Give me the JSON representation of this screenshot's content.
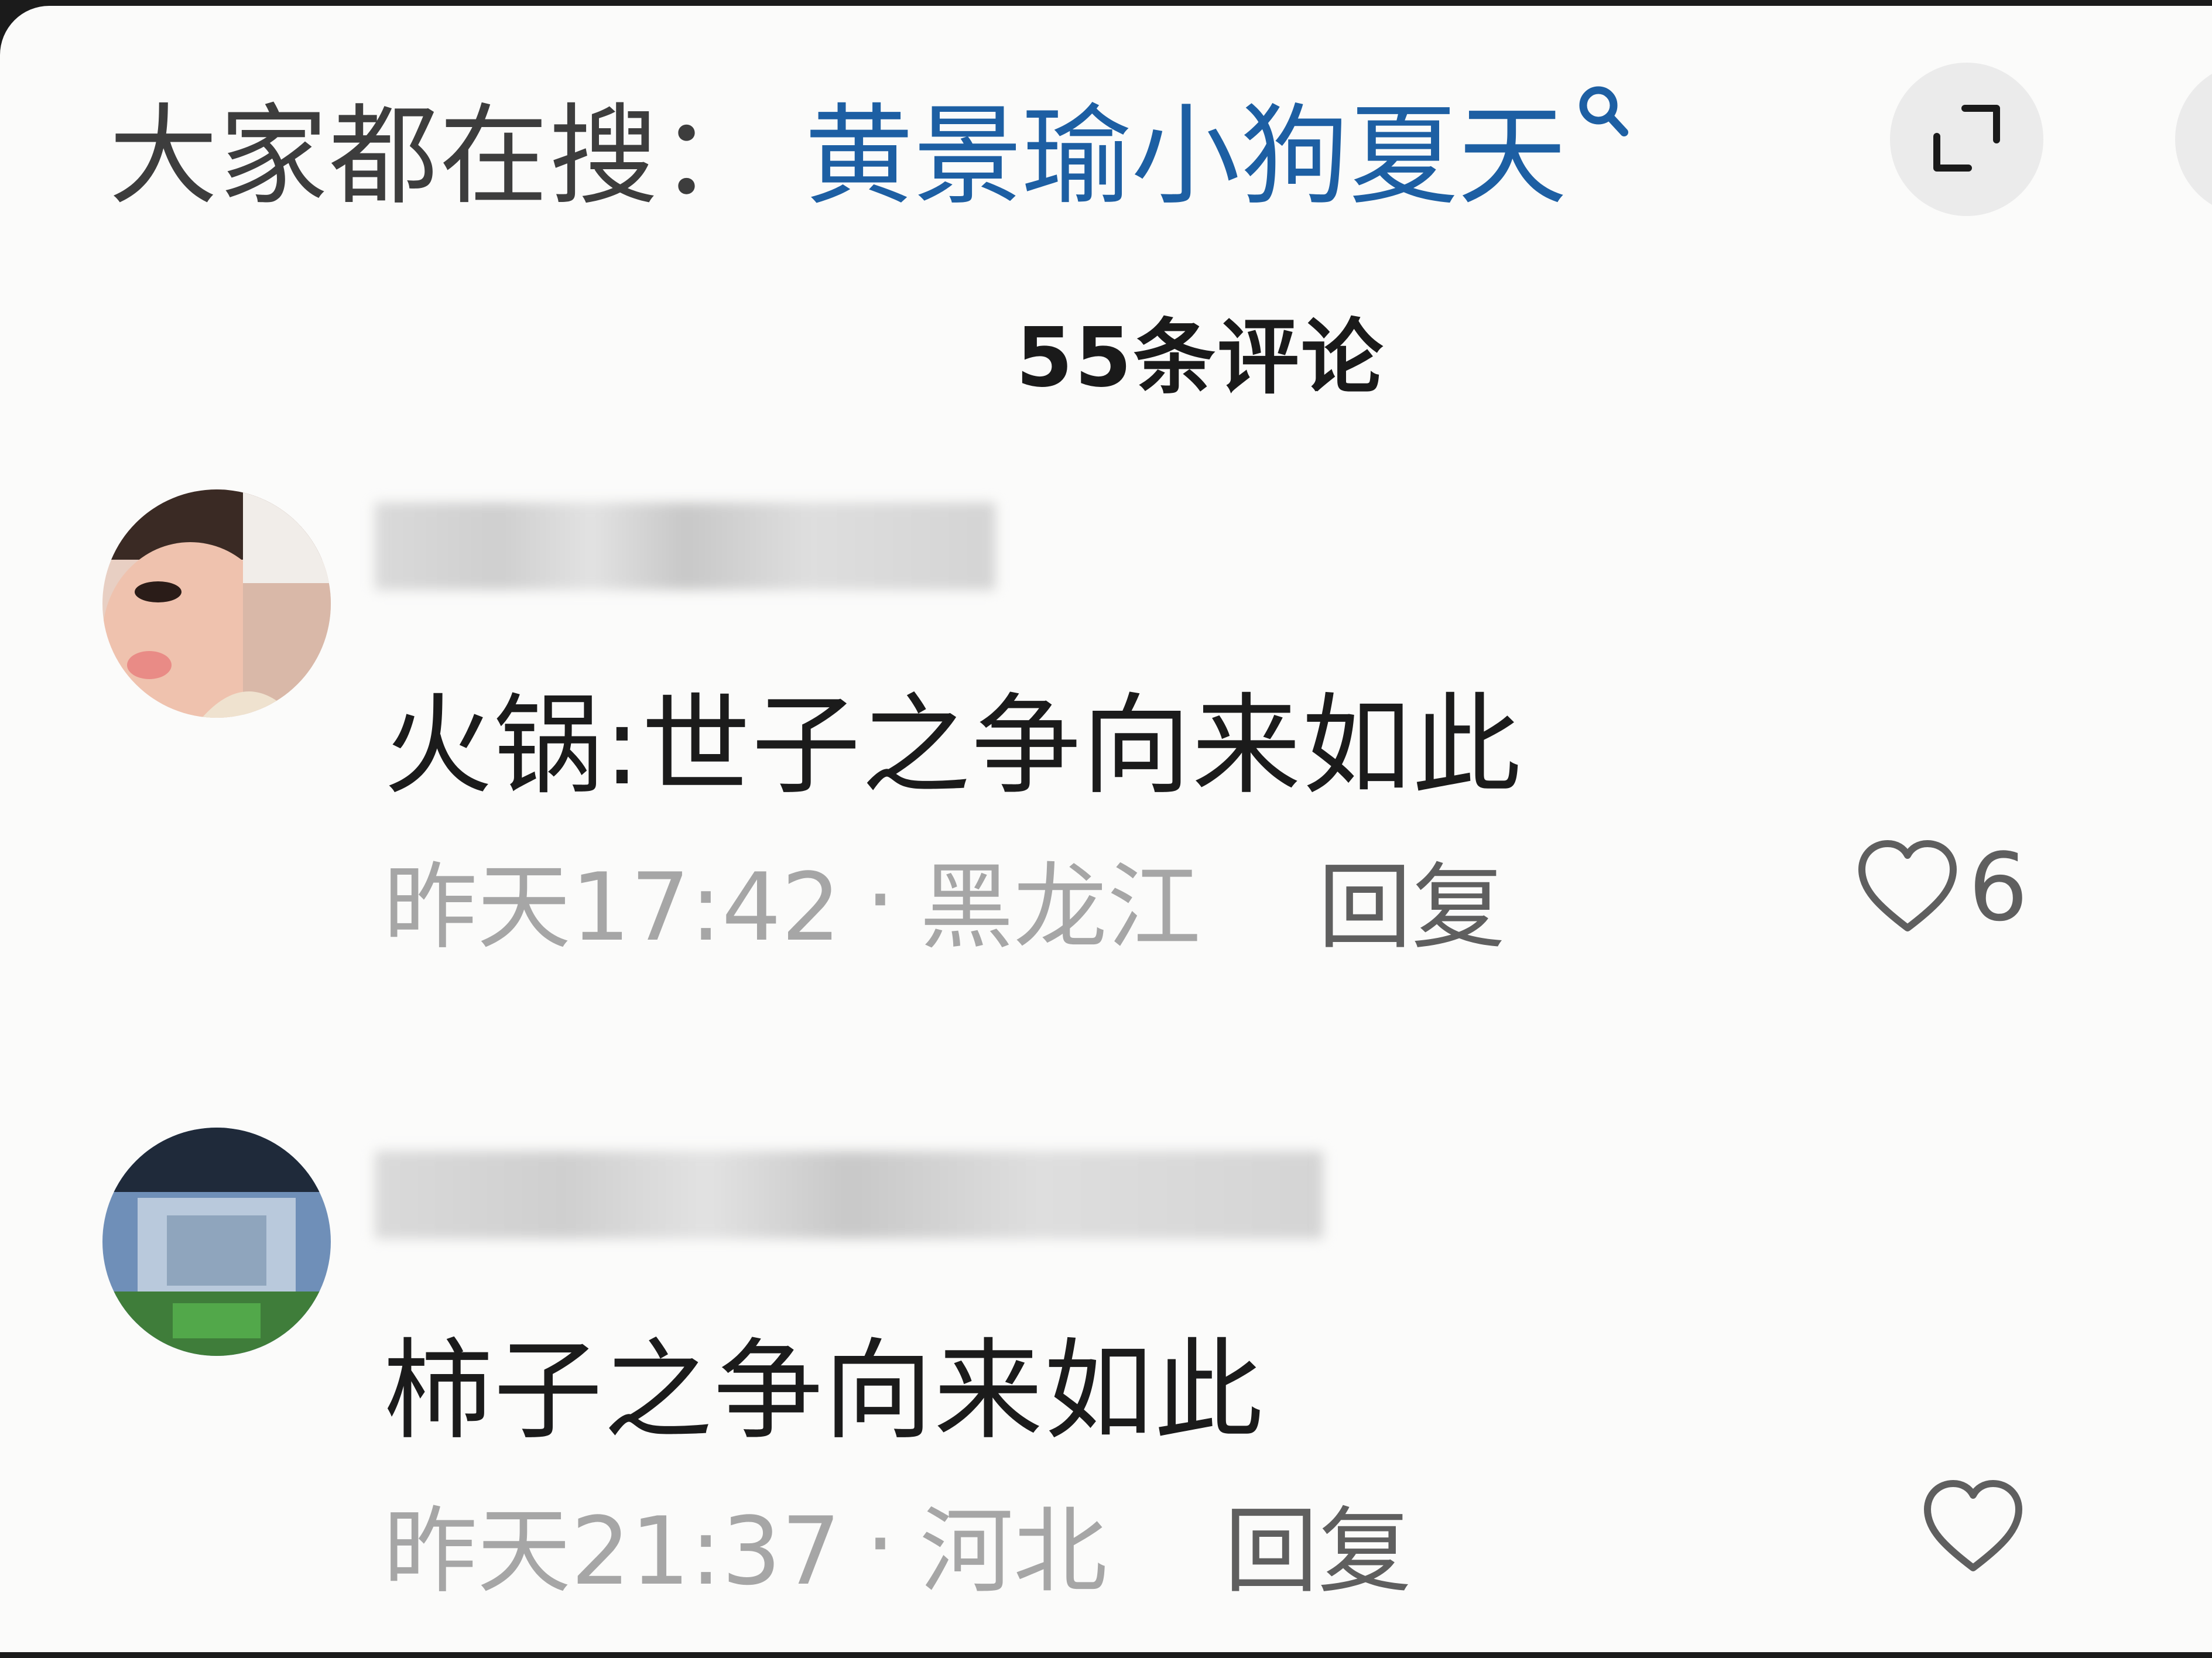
{
  "search": {
    "prefix": "大家都在搜：",
    "keyword": "黄景瑜小狗夏天"
  },
  "comment_count_label": "55条评论",
  "comments": [
    {
      "text": "火锅:世子之争向来如此",
      "time": "昨天17:42",
      "separator": "·",
      "location": "黑龙江",
      "reply_label": "回复",
      "like_count": "6"
    },
    {
      "text": "柿子之争向来如此",
      "time": "昨天21:37",
      "separator": "·",
      "location": "河北",
      "reply_label": "回复",
      "like_count": ""
    }
  ],
  "icons": {
    "search": "search-icon",
    "expand": "expand-icon",
    "like": "heart-outline-icon"
  },
  "colors": {
    "keyword": "#1d5fa3",
    "text": "#1b1b1b",
    "meta": "#a6a6a6",
    "background": "#fbfbfa"
  }
}
